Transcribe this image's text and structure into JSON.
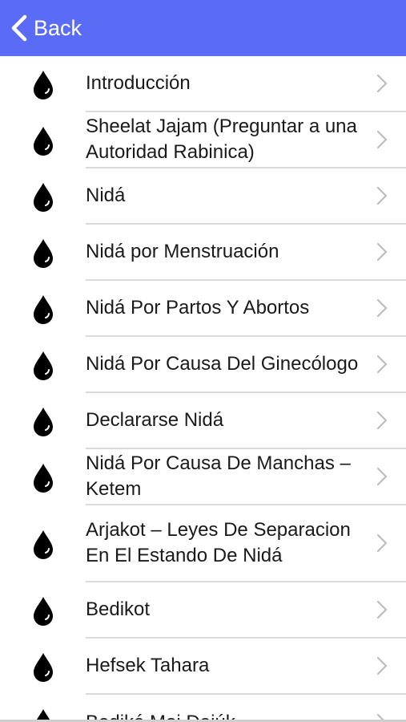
{
  "navbar": {
    "back_label": "Back",
    "color": "#5a6cf5"
  },
  "icons": {
    "row_icon": "water-drop-icon",
    "row_chevron": "chevron-right-icon",
    "back": "chevron-left-icon"
  },
  "items": [
    {
      "label": "Introducción"
    },
    {
      "label": "Sheelat Jajam (Preguntar a una Autoridad Rabinica)"
    },
    {
      "label": "Nidá"
    },
    {
      "label": "Nidá por Menstruación"
    },
    {
      "label": "Nidá Por Partos Y Abortos"
    },
    {
      "label": "Nidá Por Causa Del Ginecólogo"
    },
    {
      "label": "Declararse Nidá"
    },
    {
      "label": "Nidá Por Causa De Manchas – Ketem"
    },
    {
      "label": "Arjakot – Leyes De Separacion En El Estando De Nidá"
    },
    {
      "label": "Bedikot"
    },
    {
      "label": "Hefsek Tahara"
    },
    {
      "label": "Bediká Moj Dajúk"
    }
  ]
}
